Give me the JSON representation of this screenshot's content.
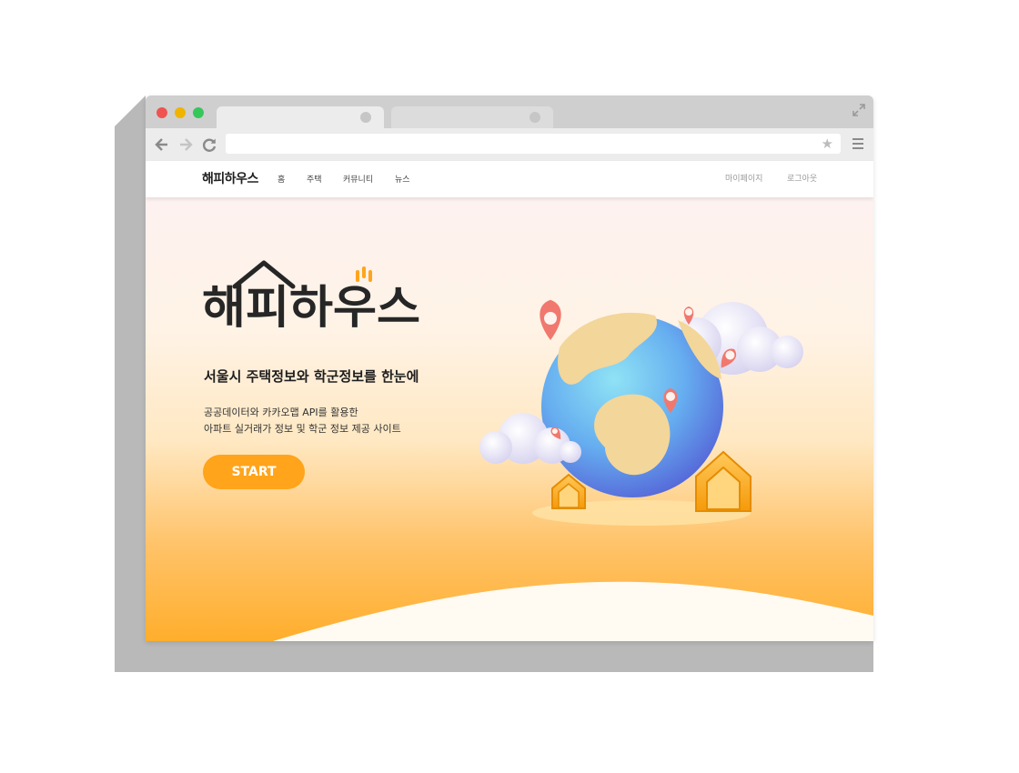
{
  "nav": {
    "logo": "해피하우스",
    "links": [
      "홈",
      "주택",
      "커뮤니티",
      "뉴스"
    ],
    "right_links": [
      "마이페이지",
      "로그아웃"
    ]
  },
  "hero": {
    "logo_text": "해피하우스",
    "title": "서울시 주택정보와 학군정보를 한눈에",
    "desc_line1": "공공데이터와 카카오맵 API를 활용한",
    "desc_line2": "아파트 실거래가 정보 및 학군 정보 제공 사이트",
    "start_label": "START"
  },
  "colors": {
    "accent": "#ffa41b",
    "globe_blue": "#5b8ee8",
    "land": "#f3d69a",
    "pin": "#f0786e"
  },
  "icons": [
    "back-arrow-icon",
    "forward-arrow-icon",
    "reload-icon",
    "star-icon",
    "menu-icon",
    "expand-icon"
  ]
}
